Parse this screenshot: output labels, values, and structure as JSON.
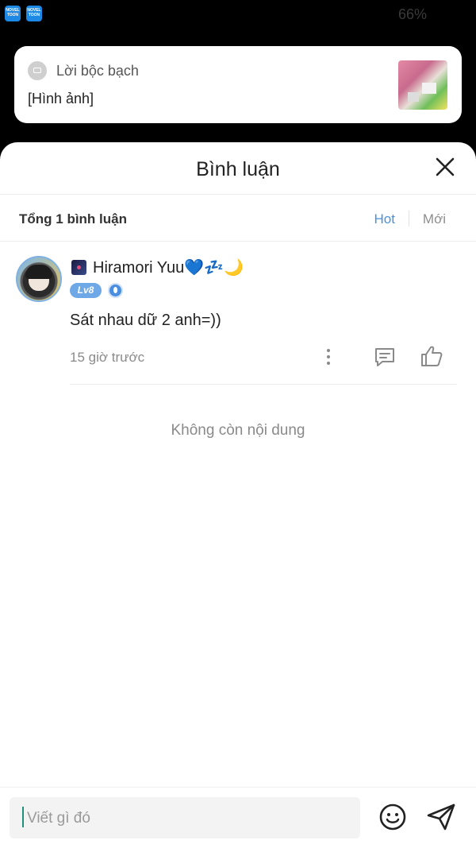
{
  "status_bar": {
    "app_badge_text": "NOVEL TOON",
    "battery": "66%"
  },
  "notification": {
    "title": "Lời bộc bạch",
    "body": "[Hình ảnh]"
  },
  "sheet": {
    "title": "Bình luận",
    "total": "Tổng 1 bình luận",
    "sort_hot": "Hot",
    "sort_new": "Mới",
    "end_text": "Không còn nội dung"
  },
  "comments": [
    {
      "username": "Hiramori Yuu💙💤🌙",
      "level": "Lv8",
      "text": "Sát nhau dữ 2 anh=))",
      "time": "15 giờ trước"
    }
  ],
  "input": {
    "placeholder": "Viết gì đó"
  },
  "colors": {
    "accent": "#4a90d9",
    "level_badge": "#6fa8e6",
    "caret": "#1e8f7a"
  },
  "icons": [
    "close-icon",
    "more-vertical-icon",
    "reply-icon",
    "like-icon",
    "emoji-icon",
    "send-icon"
  ]
}
